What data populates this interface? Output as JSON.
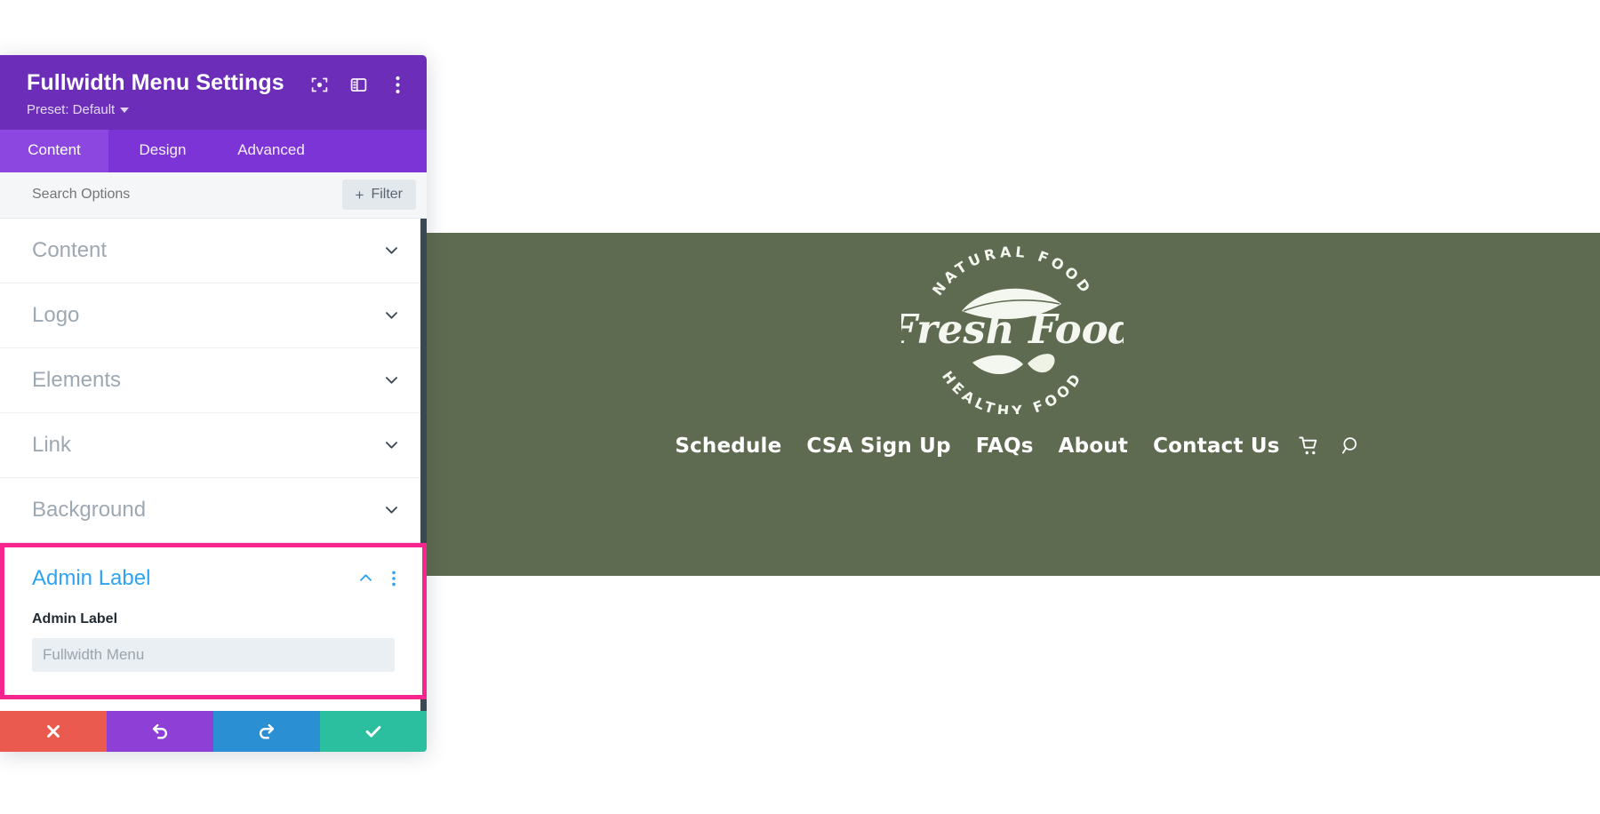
{
  "site": {
    "header_bg": "#5f6b51",
    "logo": {
      "top_arc_text": "NATURAL FOOD",
      "bottom_arc_text": "HEALTHY FOOD",
      "wordmark": "Fresh Food"
    },
    "nav": {
      "items": [
        {
          "label": "Schedule"
        },
        {
          "label": "CSA Sign Up"
        },
        {
          "label": "FAQs"
        },
        {
          "label": "About"
        },
        {
          "label": "Contact Us"
        }
      ],
      "icons": [
        {
          "name": "cart-icon"
        },
        {
          "name": "search-icon"
        }
      ]
    }
  },
  "panel": {
    "title": "Fullwidth Menu Settings",
    "preset_label": "Preset: Default",
    "header_bg": "#6c2eb9",
    "titlebar_icons": [
      {
        "name": "focus-icon"
      },
      {
        "name": "layout-panel-icon"
      },
      {
        "name": "kebab-menu-icon"
      }
    ],
    "tabs": [
      {
        "label": "Content",
        "active": true
      },
      {
        "label": "Design",
        "active": false
      },
      {
        "label": "Advanced",
        "active": false
      }
    ],
    "search": {
      "placeholder": "Search Options",
      "value": ""
    },
    "filter_button": {
      "label": "Filter",
      "plus": "+"
    },
    "sections": [
      {
        "label": "Content",
        "state": "collapsed"
      },
      {
        "label": "Logo",
        "state": "collapsed"
      },
      {
        "label": "Elements",
        "state": "collapsed"
      },
      {
        "label": "Link",
        "state": "collapsed"
      },
      {
        "label": "Background",
        "state": "collapsed"
      }
    ],
    "open_section": {
      "label": "Admin Label",
      "state": "expanded",
      "highlight_color": "#f7268e",
      "accent_color": "#2ea3f2",
      "field": {
        "label": "Admin Label",
        "value": "",
        "placeholder": "Fullwidth Menu"
      }
    },
    "footer_buttons": [
      {
        "name": "cancel-button",
        "icon": "close-icon",
        "color": "#eb5a4f"
      },
      {
        "name": "undo-button",
        "icon": "undo-icon",
        "color": "#8e3fd6"
      },
      {
        "name": "redo-button",
        "icon": "redo-icon",
        "color": "#2b8fd4"
      },
      {
        "name": "save-button",
        "icon": "check-icon",
        "color": "#2bbfa0"
      }
    ]
  }
}
